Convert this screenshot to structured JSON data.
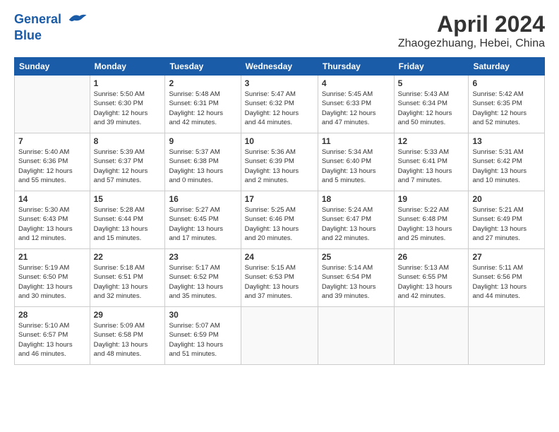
{
  "header": {
    "logo_line1": "General",
    "logo_line2": "Blue",
    "month": "April 2024",
    "location": "Zhaogezhuang, Hebei, China"
  },
  "weekdays": [
    "Sunday",
    "Monday",
    "Tuesday",
    "Wednesday",
    "Thursday",
    "Friday",
    "Saturday"
  ],
  "weeks": [
    [
      {
        "day": "",
        "info": ""
      },
      {
        "day": "1",
        "info": "Sunrise: 5:50 AM\nSunset: 6:30 PM\nDaylight: 12 hours\nand 39 minutes."
      },
      {
        "day": "2",
        "info": "Sunrise: 5:48 AM\nSunset: 6:31 PM\nDaylight: 12 hours\nand 42 minutes."
      },
      {
        "day": "3",
        "info": "Sunrise: 5:47 AM\nSunset: 6:32 PM\nDaylight: 12 hours\nand 44 minutes."
      },
      {
        "day": "4",
        "info": "Sunrise: 5:45 AM\nSunset: 6:33 PM\nDaylight: 12 hours\nand 47 minutes."
      },
      {
        "day": "5",
        "info": "Sunrise: 5:43 AM\nSunset: 6:34 PM\nDaylight: 12 hours\nand 50 minutes."
      },
      {
        "day": "6",
        "info": "Sunrise: 5:42 AM\nSunset: 6:35 PM\nDaylight: 12 hours\nand 52 minutes."
      }
    ],
    [
      {
        "day": "7",
        "info": "Sunrise: 5:40 AM\nSunset: 6:36 PM\nDaylight: 12 hours\nand 55 minutes."
      },
      {
        "day": "8",
        "info": "Sunrise: 5:39 AM\nSunset: 6:37 PM\nDaylight: 12 hours\nand 57 minutes."
      },
      {
        "day": "9",
        "info": "Sunrise: 5:37 AM\nSunset: 6:38 PM\nDaylight: 13 hours\nand 0 minutes."
      },
      {
        "day": "10",
        "info": "Sunrise: 5:36 AM\nSunset: 6:39 PM\nDaylight: 13 hours\nand 2 minutes."
      },
      {
        "day": "11",
        "info": "Sunrise: 5:34 AM\nSunset: 6:40 PM\nDaylight: 13 hours\nand 5 minutes."
      },
      {
        "day": "12",
        "info": "Sunrise: 5:33 AM\nSunset: 6:41 PM\nDaylight: 13 hours\nand 7 minutes."
      },
      {
        "day": "13",
        "info": "Sunrise: 5:31 AM\nSunset: 6:42 PM\nDaylight: 13 hours\nand 10 minutes."
      }
    ],
    [
      {
        "day": "14",
        "info": "Sunrise: 5:30 AM\nSunset: 6:43 PM\nDaylight: 13 hours\nand 12 minutes."
      },
      {
        "day": "15",
        "info": "Sunrise: 5:28 AM\nSunset: 6:44 PM\nDaylight: 13 hours\nand 15 minutes."
      },
      {
        "day": "16",
        "info": "Sunrise: 5:27 AM\nSunset: 6:45 PM\nDaylight: 13 hours\nand 17 minutes."
      },
      {
        "day": "17",
        "info": "Sunrise: 5:25 AM\nSunset: 6:46 PM\nDaylight: 13 hours\nand 20 minutes."
      },
      {
        "day": "18",
        "info": "Sunrise: 5:24 AM\nSunset: 6:47 PM\nDaylight: 13 hours\nand 22 minutes."
      },
      {
        "day": "19",
        "info": "Sunrise: 5:22 AM\nSunset: 6:48 PM\nDaylight: 13 hours\nand 25 minutes."
      },
      {
        "day": "20",
        "info": "Sunrise: 5:21 AM\nSunset: 6:49 PM\nDaylight: 13 hours\nand 27 minutes."
      }
    ],
    [
      {
        "day": "21",
        "info": "Sunrise: 5:19 AM\nSunset: 6:50 PM\nDaylight: 13 hours\nand 30 minutes."
      },
      {
        "day": "22",
        "info": "Sunrise: 5:18 AM\nSunset: 6:51 PM\nDaylight: 13 hours\nand 32 minutes."
      },
      {
        "day": "23",
        "info": "Sunrise: 5:17 AM\nSunset: 6:52 PM\nDaylight: 13 hours\nand 35 minutes."
      },
      {
        "day": "24",
        "info": "Sunrise: 5:15 AM\nSunset: 6:53 PM\nDaylight: 13 hours\nand 37 minutes."
      },
      {
        "day": "25",
        "info": "Sunrise: 5:14 AM\nSunset: 6:54 PM\nDaylight: 13 hours\nand 39 minutes."
      },
      {
        "day": "26",
        "info": "Sunrise: 5:13 AM\nSunset: 6:55 PM\nDaylight: 13 hours\nand 42 minutes."
      },
      {
        "day": "27",
        "info": "Sunrise: 5:11 AM\nSunset: 6:56 PM\nDaylight: 13 hours\nand 44 minutes."
      }
    ],
    [
      {
        "day": "28",
        "info": "Sunrise: 5:10 AM\nSunset: 6:57 PM\nDaylight: 13 hours\nand 46 minutes."
      },
      {
        "day": "29",
        "info": "Sunrise: 5:09 AM\nSunset: 6:58 PM\nDaylight: 13 hours\nand 48 minutes."
      },
      {
        "day": "30",
        "info": "Sunrise: 5:07 AM\nSunset: 6:59 PM\nDaylight: 13 hours\nand 51 minutes."
      },
      {
        "day": "",
        "info": ""
      },
      {
        "day": "",
        "info": ""
      },
      {
        "day": "",
        "info": ""
      },
      {
        "day": "",
        "info": ""
      }
    ]
  ]
}
